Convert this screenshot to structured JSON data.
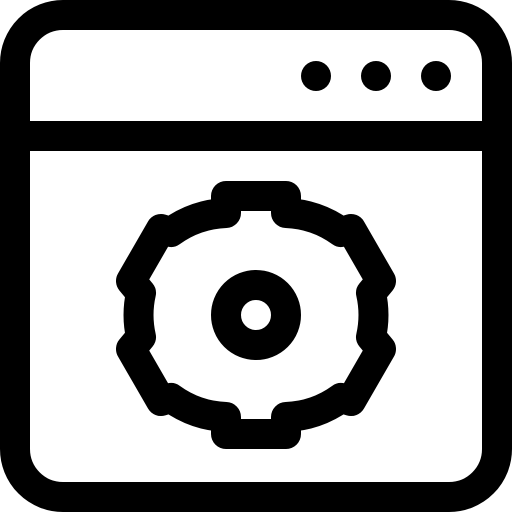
{
  "icon": {
    "semantic_name": "browser-settings-icon",
    "parts": [
      "browser-window-icon",
      "titlebar-dots-icon",
      "gear-icon"
    ],
    "colors": {
      "stroke": "#000000",
      "background": "#ffffff"
    }
  }
}
